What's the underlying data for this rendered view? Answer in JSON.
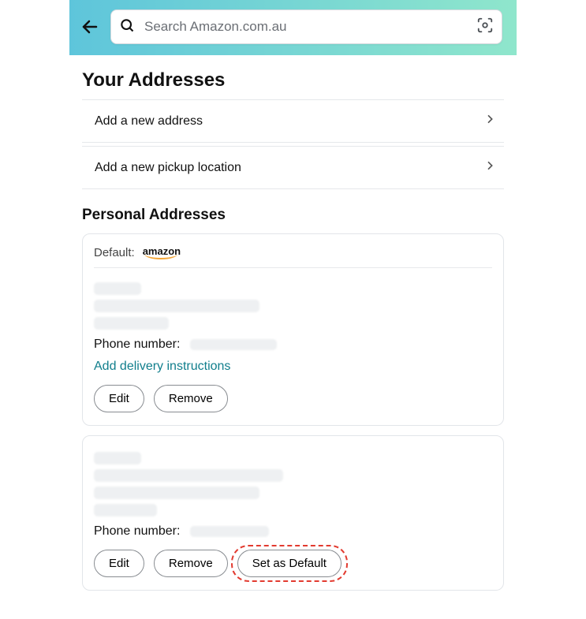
{
  "header": {
    "search_placeholder": "Search Amazon.com.au"
  },
  "page": {
    "title": "Your Addresses",
    "add_address": "Add a new address",
    "add_pickup": "Add a new pickup location",
    "section_title": "Personal Addresses"
  },
  "labels": {
    "default": "Default:",
    "phone": "Phone number:",
    "add_instructions": "Add delivery instructions",
    "edit": "Edit",
    "remove": "Remove",
    "set_default": "Set as Default"
  }
}
